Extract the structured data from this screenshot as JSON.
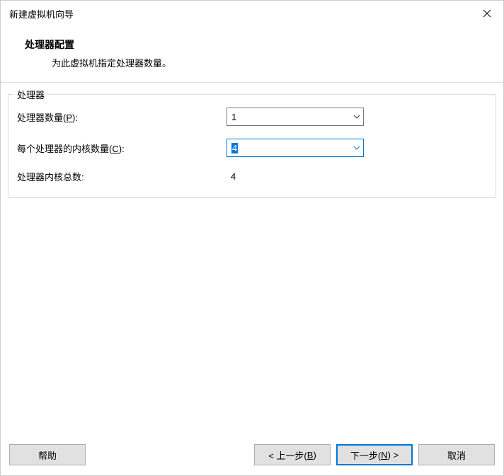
{
  "window": {
    "title": "新建虚拟机向导"
  },
  "header": {
    "title": "处理器配置",
    "desc": "为此虚拟机指定处理器数量。"
  },
  "group": {
    "title": "处理器",
    "processors": {
      "label_pre": "处理器数量(",
      "hotkey": "P",
      "label_post": "):",
      "value": "1"
    },
    "cores": {
      "label_pre": "每个处理器的内核数量(",
      "hotkey": "C",
      "label_post": "):",
      "value": "4"
    },
    "total": {
      "label": "处理器内核总数:",
      "value": "4"
    }
  },
  "footer": {
    "help": "帮助",
    "back_pre": "< 上一步(",
    "back_hotkey": "B",
    "back_post": ")",
    "next_pre": "下一步(",
    "next_hotkey": "N",
    "next_post": ") >",
    "cancel": "取消"
  }
}
